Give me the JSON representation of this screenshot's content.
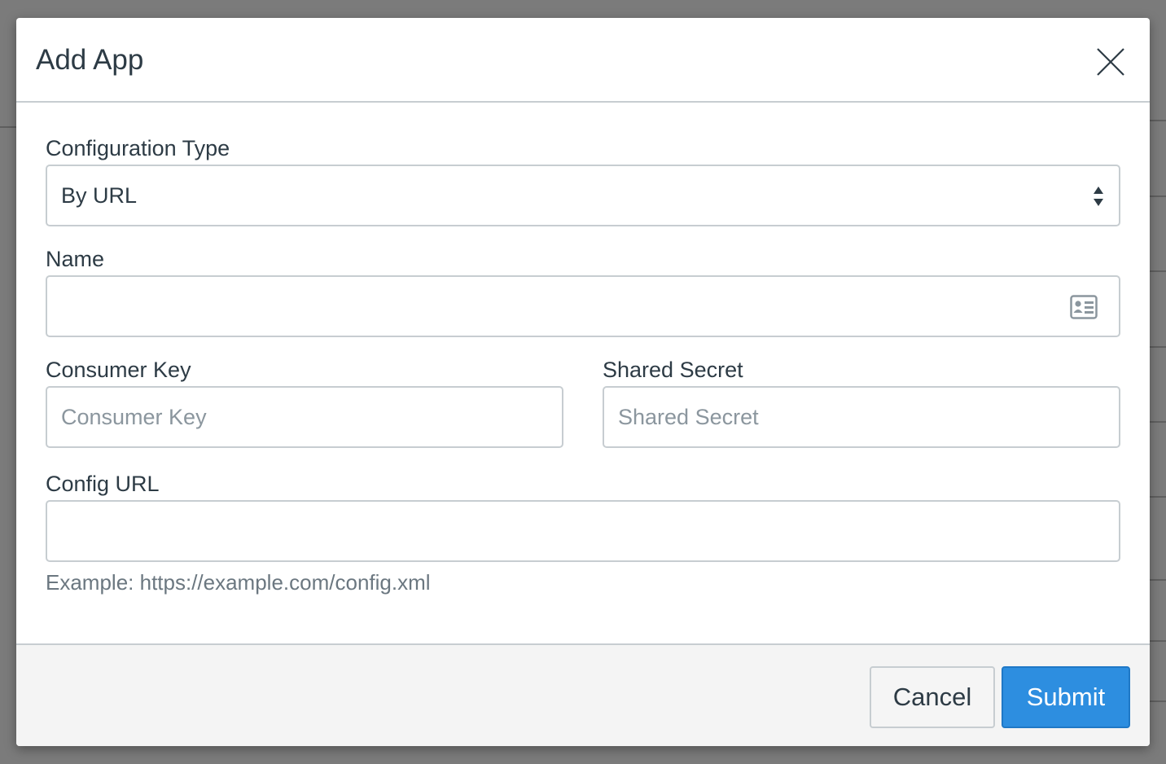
{
  "dialog": {
    "title": "Add App",
    "close_icon": "close-icon"
  },
  "form": {
    "configuration_type": {
      "label": "Configuration Type",
      "selected": "By URL",
      "icon": "select-arrows-icon"
    },
    "name": {
      "label": "Name",
      "value": "",
      "placeholder": "",
      "icon": "contact-card-icon"
    },
    "consumer_key": {
      "label": "Consumer Key",
      "value": "",
      "placeholder": "Consumer Key"
    },
    "shared_secret": {
      "label": "Shared Secret",
      "value": "",
      "placeholder": "Shared Secret"
    },
    "config_url": {
      "label": "Config URL",
      "value": "",
      "placeholder": "",
      "hint": "Example: https://example.com/config.xml"
    }
  },
  "footer": {
    "cancel_label": "Cancel",
    "submit_label": "Submit"
  },
  "colors": {
    "primary": "#2d8ee0",
    "overlay": "#7b7b7b",
    "border": "#c7cdd1",
    "text": "#2d3b45"
  }
}
